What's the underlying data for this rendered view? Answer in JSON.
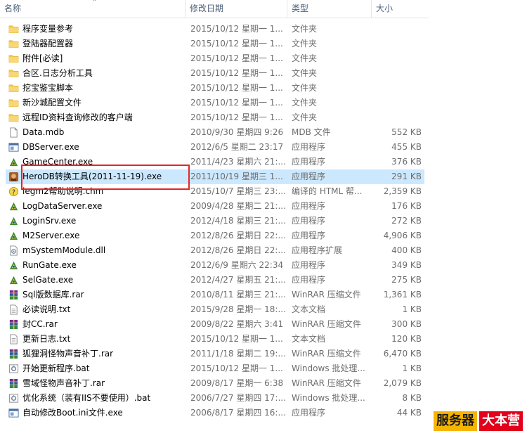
{
  "columns": {
    "name": "名称",
    "date": "修改日期",
    "type": "类型",
    "size": "大小"
  },
  "colors": {
    "selection": "#cce8ff",
    "highlight_border": "#e2262a",
    "folder": "#f3c84b"
  },
  "files": [
    {
      "name": "程序变量参考",
      "date": "2015/10/12 星期一 1...",
      "type": "文件夹",
      "size": "",
      "icon": "folder-icon"
    },
    {
      "name": "登陆器配置器",
      "date": "2015/10/12 星期一 1...",
      "type": "文件夹",
      "size": "",
      "icon": "folder-icon"
    },
    {
      "name": "附件[必读]",
      "date": "2015/10/12 星期一 1...",
      "type": "文件夹",
      "size": "",
      "icon": "folder-icon"
    },
    {
      "name": "合区.日志分析工具",
      "date": "2015/10/12 星期一 1...",
      "type": "文件夹",
      "size": "",
      "icon": "folder-icon"
    },
    {
      "name": "挖宝鉴宝脚本",
      "date": "2015/10/12 星期一 1...",
      "type": "文件夹",
      "size": "",
      "icon": "folder-icon"
    },
    {
      "name": "新沙城配置文件",
      "date": "2015/10/12 星期一 1...",
      "type": "文件夹",
      "size": "",
      "icon": "folder-icon"
    },
    {
      "name": "远程ID资料查询修改的客户端",
      "date": "2015/10/12 星期一 1...",
      "type": "文件夹",
      "size": "",
      "icon": "folder-icon"
    },
    {
      "name": "Data.mdb",
      "date": "2010/9/30 星期四 9:26",
      "type": "MDB 文件",
      "size": "552 KB",
      "icon": "document-icon"
    },
    {
      "name": "DBServer.exe",
      "date": "2012/6/5 星期二 23:17",
      "type": "应用程序",
      "size": "455 KB",
      "icon": "window-app-icon"
    },
    {
      "name": "GameCenter.exe",
      "date": "2011/4/23 星期六 21:...",
      "type": "应用程序",
      "size": "376 KB",
      "icon": "game-app-icon"
    },
    {
      "name": "HeroDB转换工具(2011-11-19).exe",
      "date": "2011/10/19 星期三 1...",
      "type": "应用程序",
      "size": "291 KB",
      "icon": "hero-app-icon",
      "selected": true
    },
    {
      "name": "legm2帮助说明.chm",
      "date": "2015/10/7 星期三 23:...",
      "type": "编译的 HTML 帮...",
      "size": "2,359 KB",
      "icon": "help-icon"
    },
    {
      "name": "LogDataServer.exe",
      "date": "2009/4/28 星期二 21:...",
      "type": "应用程序",
      "size": "176 KB",
      "icon": "game-app-icon"
    },
    {
      "name": "LoginSrv.exe",
      "date": "2012/4/18 星期三 21:...",
      "type": "应用程序",
      "size": "272 KB",
      "icon": "game-app-icon"
    },
    {
      "name": "M2Server.exe",
      "date": "2012/8/26 星期日 22:...",
      "type": "应用程序",
      "size": "4,906 KB",
      "icon": "game-app-icon"
    },
    {
      "name": "mSystemModule.dll",
      "date": "2012/8/26 星期日 22:...",
      "type": "应用程序扩展",
      "size": "400 KB",
      "icon": "dll-icon"
    },
    {
      "name": "RunGate.exe",
      "date": "2012/6/9 星期六 22:34",
      "type": "应用程序",
      "size": "349 KB",
      "icon": "game-app-icon"
    },
    {
      "name": "SelGate.exe",
      "date": "2012/4/27 星期五 21:...",
      "type": "应用程序",
      "size": "275 KB",
      "icon": "game-app-icon"
    },
    {
      "name": "Sql版数据库.rar",
      "date": "2010/8/11 星期三 21:...",
      "type": "WinRAR 压缩文件",
      "size": "1,361 KB",
      "icon": "rar-icon"
    },
    {
      "name": "必读说明.txt",
      "date": "2015/9/28 星期一 18:...",
      "type": "文本文档",
      "size": "1 KB",
      "icon": "text-icon"
    },
    {
      "name": "封CC.rar",
      "date": "2009/8/22 星期六 3:41",
      "type": "WinRAR 压缩文件",
      "size": "300 KB",
      "icon": "rar-icon"
    },
    {
      "name": "更新日志.txt",
      "date": "2015/10/12 星期一 1...",
      "type": "文本文档",
      "size": "120 KB",
      "icon": "text-icon"
    },
    {
      "name": "狐狸洞怪物声音补丁.rar",
      "date": "2011/1/18 星期二 19:...",
      "type": "WinRAR 压缩文件",
      "size": "6,470 KB",
      "icon": "rar-icon"
    },
    {
      "name": "开始更新程序.bat",
      "date": "2015/10/12 星期一 1...",
      "type": "Windows 批处理...",
      "size": "1 KB",
      "icon": "batch-icon"
    },
    {
      "name": "雪域怪物声音补丁.rar",
      "date": "2009/8/17 星期一 6:38",
      "type": "WinRAR 压缩文件",
      "size": "2,079 KB",
      "icon": "rar-icon"
    },
    {
      "name": "优化系统（装有IIS不要使用）.bat",
      "date": "2006/7/27 星期四 17:...",
      "type": "Windows 批处理...",
      "size": "8 KB",
      "icon": "batch-icon"
    },
    {
      "name": "自动修改Boot.ini文件.exe",
      "date": "2006/8/17 星期四 16:...",
      "type": "应用程序",
      "size": "44 KB",
      "icon": "window-app-icon"
    }
  ],
  "watermark": {
    "part1": "服务器",
    "part2": "大本营"
  }
}
